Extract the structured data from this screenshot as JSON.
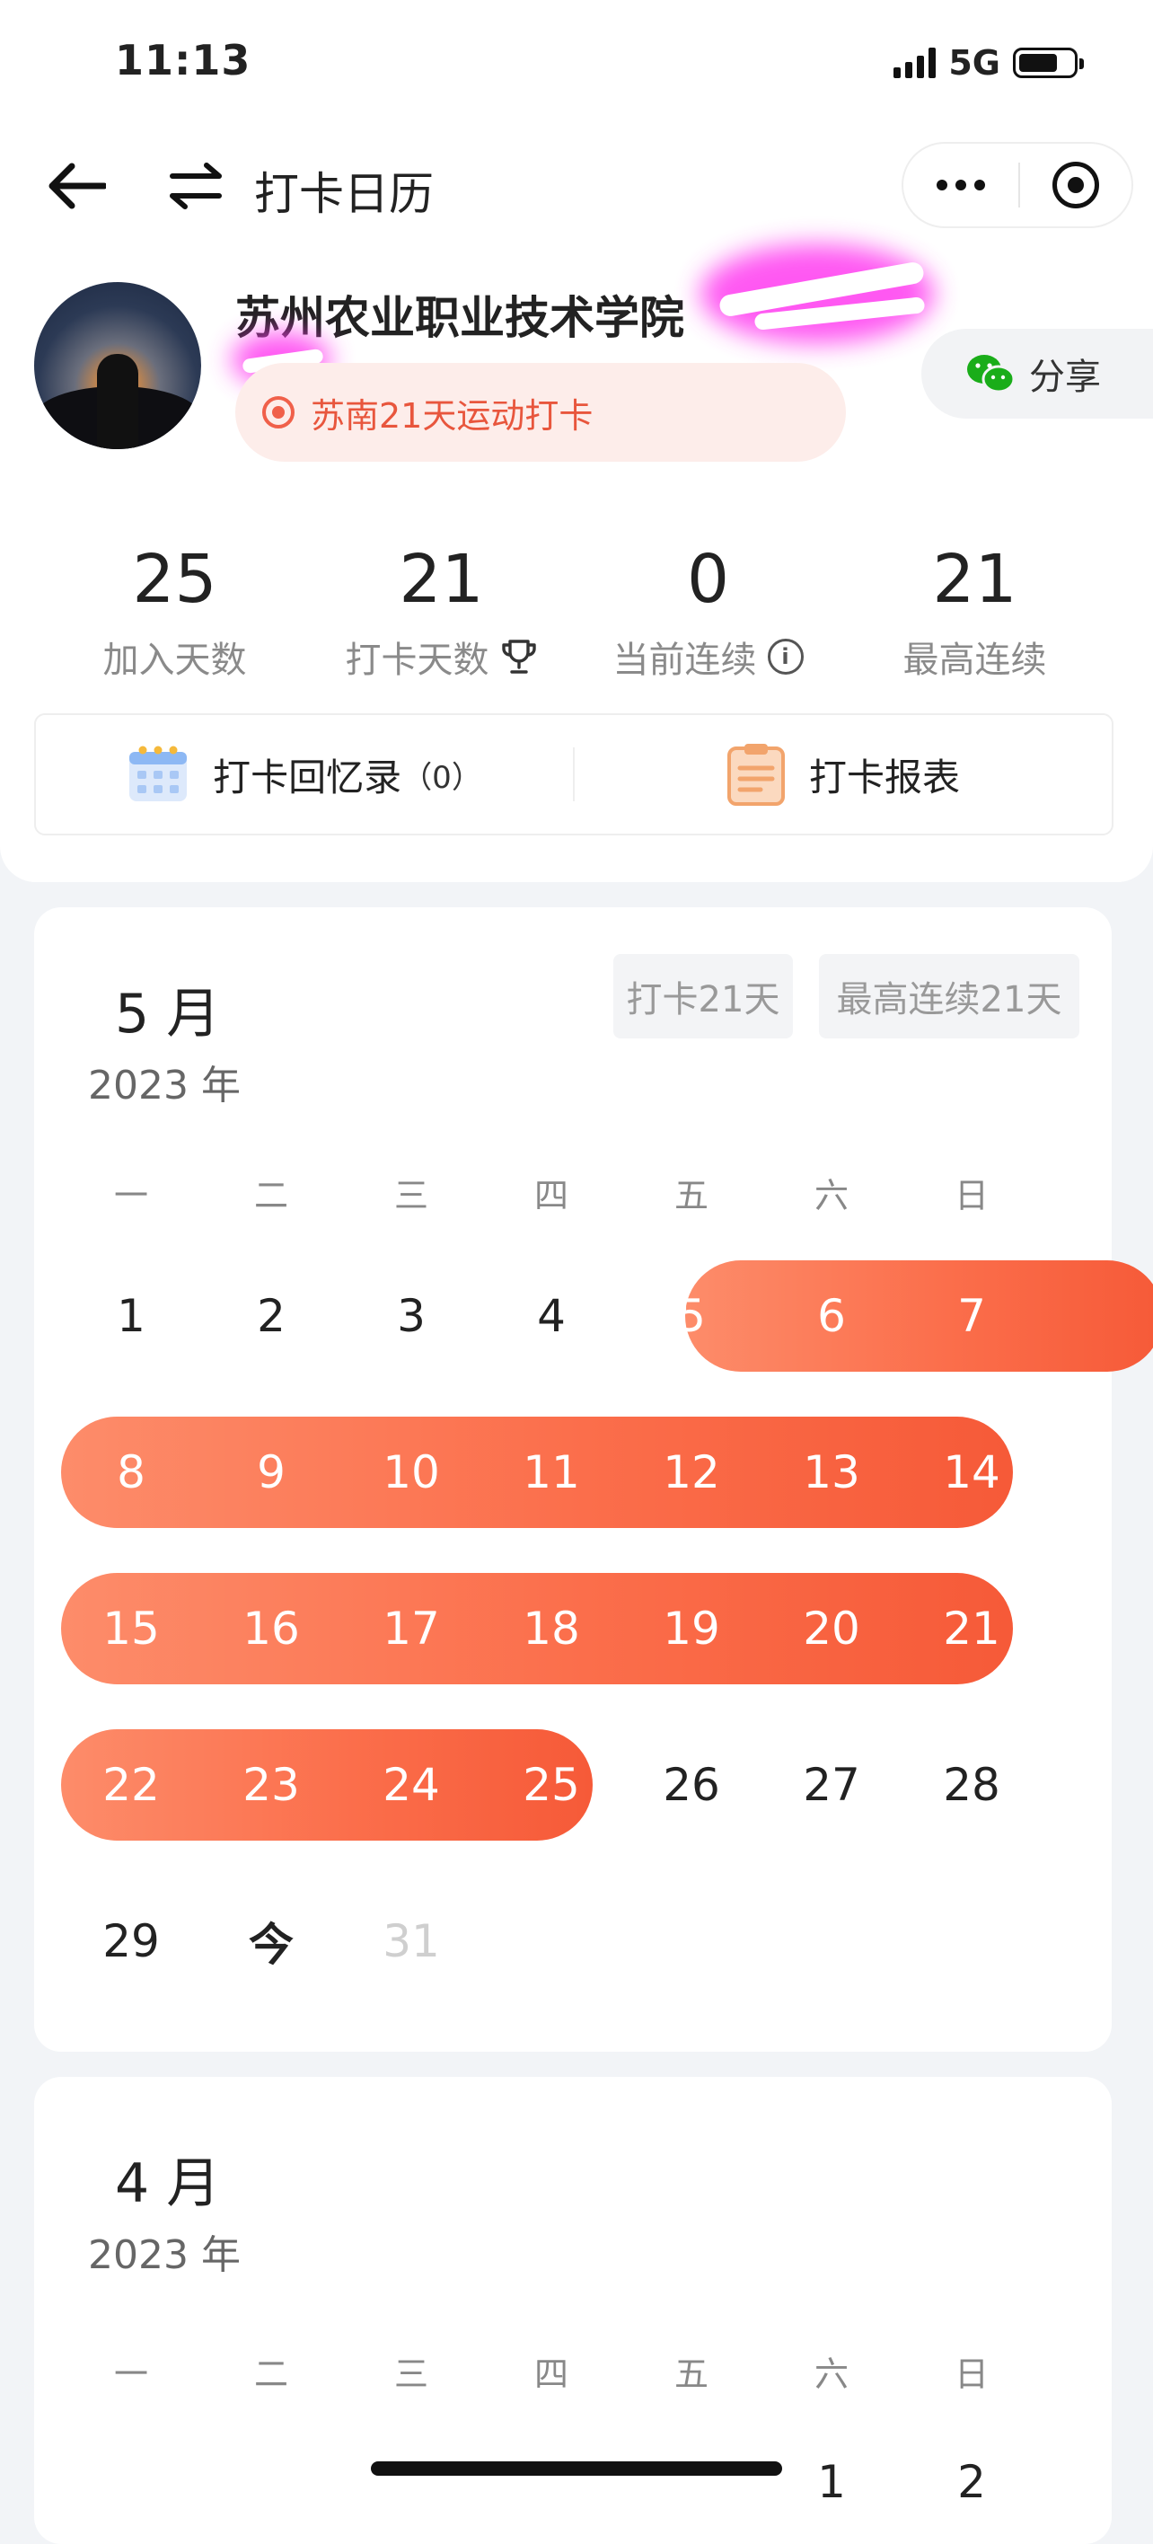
{
  "status_bar": {
    "time": "11:13",
    "network": "5G",
    "battery_level": 0.72
  },
  "nav": {
    "title": "打卡日历"
  },
  "profile": {
    "org_name": "苏州农业职业技术学院",
    "activity": "苏南21天运动打卡",
    "share_label": "分享"
  },
  "stats": [
    {
      "value": "25",
      "label": "加入天数"
    },
    {
      "value": "21",
      "label": "打卡天数"
    },
    {
      "value": "0",
      "label": "当前连续"
    },
    {
      "value": "21",
      "label": "最高连续"
    }
  ],
  "actions": {
    "memories_label": "打卡回忆录",
    "memories_count": "（0）",
    "report_label": "打卡报表"
  },
  "weekdays": [
    "一",
    "二",
    "三",
    "四",
    "五",
    "六",
    "日"
  ],
  "may": {
    "month": "5 月",
    "year": "2023 年",
    "checkin_badge": "打卡21天",
    "streak_badge": "最高连续21天",
    "rows": [
      [
        "1",
        "2",
        "3",
        "4",
        "5",
        "6",
        "7"
      ],
      [
        "8",
        "9",
        "10",
        "11",
        "12",
        "13",
        "14"
      ],
      [
        "15",
        "16",
        "17",
        "18",
        "19",
        "20",
        "21"
      ],
      [
        "22",
        "23",
        "24",
        "25",
        "26",
        "27",
        "28"
      ],
      [
        "29",
        "今",
        "31",
        "",
        "",
        "",
        ""
      ]
    ],
    "checked_days": [
      5,
      25
    ]
  },
  "april": {
    "month": "4 月",
    "year": "2023 年",
    "first_row": [
      "",
      "",
      "",
      "",
      "",
      "1",
      "2"
    ]
  },
  "colors": {
    "accent": "#F8603E",
    "accent_light": "#FD8C6A",
    "tag_bg": "#FDEDEA"
  }
}
